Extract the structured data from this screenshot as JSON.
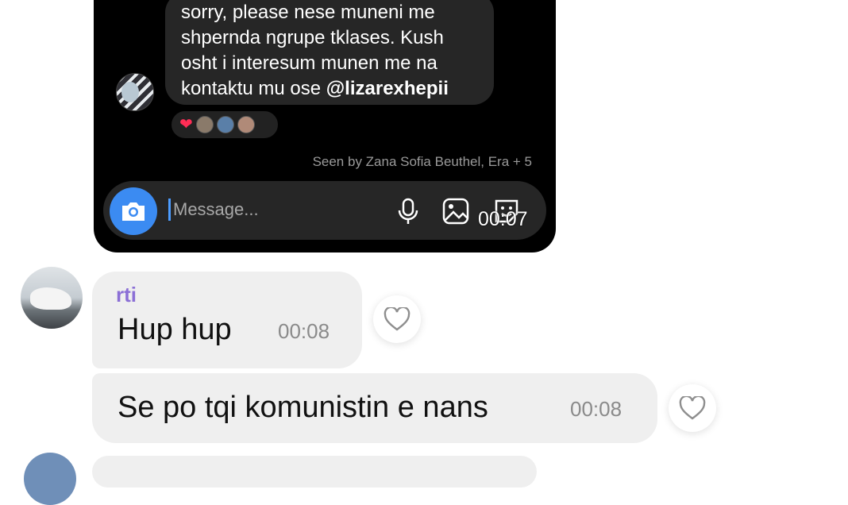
{
  "shared_screenshot": {
    "message_lines": [
      "sorry, please nese muneni me",
      "shpernda ngrupe tklases. Kush",
      "osht i interesum munen me na",
      "kontaktu mu ose "
    ],
    "mention": "@lizarexhepii",
    "seen_text": "Seen by Zana Sofia Beuthel, Era + 5",
    "composer_placeholder": "Message...",
    "overlay_time": "00:07",
    "icons": [
      "camera-icon",
      "mic-icon",
      "gallery-icon",
      "sticker-icon",
      "heart-icon"
    ],
    "colors": {
      "background": "#000000",
      "bubble": "#262626",
      "camera_button": "#3b8bf2",
      "heart": "#ff2d55"
    }
  },
  "chat": {
    "messages": [
      {
        "sender": "rti",
        "text": "Hup hup",
        "time": "00:08"
      },
      {
        "text": "Se po tqi komunistin e nans",
        "time": "00:08"
      }
    ],
    "colors": {
      "bubble": "#efefef",
      "sender_name": "#8b6fd6",
      "time": "#8a8a8a"
    }
  }
}
